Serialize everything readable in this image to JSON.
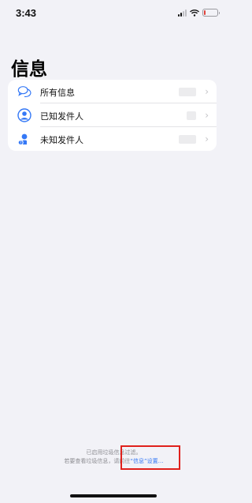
{
  "status_bar": {
    "time": "3:43",
    "icons": [
      "cellular-signal-icon",
      "wifi-icon",
      "battery-low-icon"
    ],
    "battery_level_fraction": 0.15
  },
  "page": {
    "title": "信息"
  },
  "filter_list": {
    "items": [
      {
        "label": "所有信息",
        "icon": "speech-bubbles-icon"
      },
      {
        "label": "已知发件人",
        "icon": "person-circle-icon"
      },
      {
        "label": "未知发件人",
        "icon": "person-question-icon"
      }
    ],
    "chevron": "›"
  },
  "footer": {
    "line1": "已启用垃圾信息过滤。",
    "line2_prefix": "若要查看垃圾信息，请前往",
    "line2_link": "“信息”设置…"
  },
  "colors": {
    "background": "#f2f2f7",
    "accent": "#3478f6",
    "highlight_border": "#e0211c",
    "battery_low": "#e0413a"
  }
}
